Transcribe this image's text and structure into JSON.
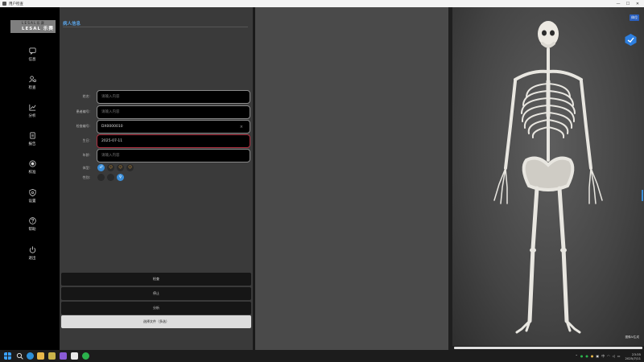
{
  "window": {
    "title": "用户检查"
  },
  "sidebar": {
    "logo_top": "L E S A L 乐 赛",
    "logo_brand": "LESAL 乐赛",
    "items": [
      {
        "label": "信息",
        "icon": "chat-icon"
      },
      {
        "label": "检查",
        "icon": "person-search-icon"
      },
      {
        "label": "分析",
        "icon": "chart-icon"
      },
      {
        "label": "报告",
        "icon": "report-icon"
      },
      {
        "label": "校准",
        "icon": "calibrate-icon"
      },
      {
        "label": "设置",
        "icon": "shield-settings-icon"
      },
      {
        "label": "帮助",
        "icon": "help-icon"
      },
      {
        "label": "退出",
        "icon": "power-icon"
      }
    ]
  },
  "form": {
    "section_title": "病人信息",
    "fields": [
      {
        "label": "姓名:",
        "value": "",
        "placeholder": "请输入内容"
      },
      {
        "label": "患者编号:",
        "value": "",
        "placeholder": "请输入内容"
      },
      {
        "label": "检查编号:",
        "value": "DX0000010",
        "placeholder": ""
      },
      {
        "label": "生日:",
        "value": "2025-07-11",
        "placeholder": ""
      },
      {
        "label": "年龄:",
        "value": "",
        "placeholder": "请输入内容"
      }
    ],
    "clear_glyph": "×",
    "body_type": {
      "label": "体型:",
      "options": [
        "♂",
        "☺",
        "☺",
        "☺"
      ]
    },
    "gender": {
      "label": "性别:",
      "options": [
        "",
        "",
        "♀"
      ]
    },
    "actions": {
      "check": "检查",
      "stop": "停止",
      "analyze": "分析",
      "select_file": "选择文件（多选）"
    }
  },
  "viewer": {
    "tag": "体位",
    "credit": "图像AI生成",
    "ai_badge_icon": "bird-badge-icon"
  },
  "taskbar": {
    "time": "23:35",
    "date": "2025/7/11",
    "lang": "中"
  },
  "colors": {
    "accent": "#3b8ed8",
    "error_border": "#b03040",
    "title_blue": "#5aa0e0"
  }
}
